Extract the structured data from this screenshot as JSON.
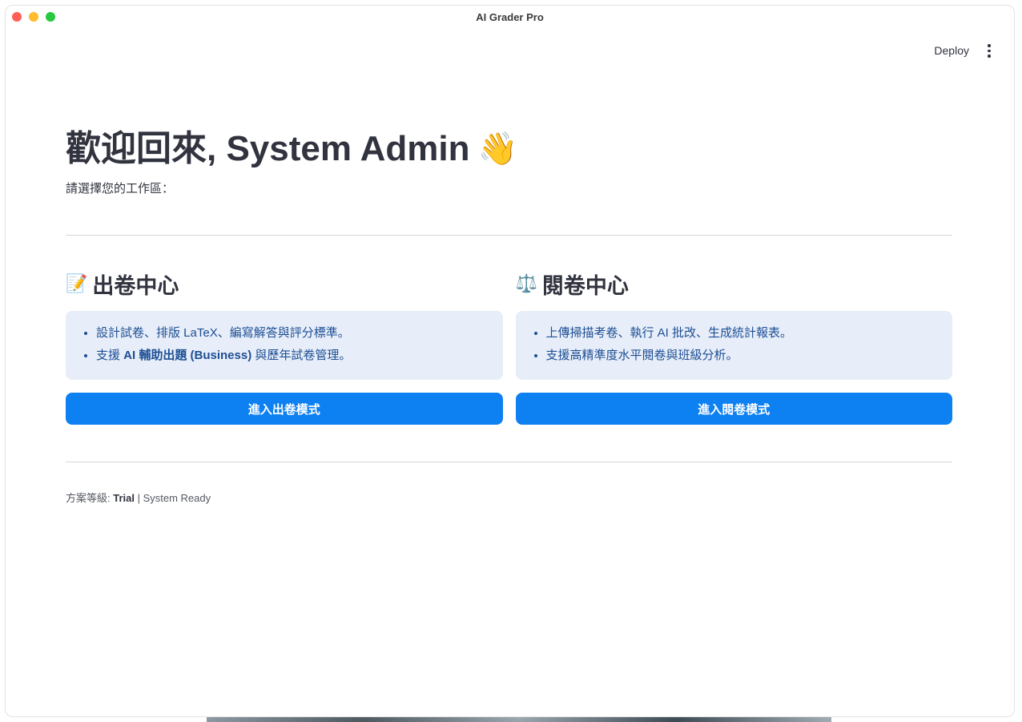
{
  "window": {
    "title": "AI Grader Pro"
  },
  "toolbar": {
    "deploy_label": "Deploy",
    "menu_icon": "more-vertical-icon"
  },
  "main": {
    "welcome_text": "歡迎回來, System Admin",
    "welcome_emoji": "👋",
    "subtitle": "請選擇您的工作區："
  },
  "workspaces": [
    {
      "emoji": "📝",
      "title": "出卷中心",
      "bullets": [
        {
          "prefix": "設計試卷、排版 LaTeX、編寫解答與評分標準。",
          "bold": "",
          "suffix": ""
        },
        {
          "prefix": "支援 ",
          "bold": "AI 輔助出題 (Business)",
          "suffix": " 與歷年試卷管理。"
        }
      ],
      "button_label": "進入出卷模式"
    },
    {
      "emoji": "⚖️",
      "title": "閱卷中心",
      "bullets": [
        {
          "prefix": "上傳掃描考卷、執行 AI 批改、生成統計報表。",
          "bold": "",
          "suffix": ""
        },
        {
          "prefix": "支援高精準度水平閱卷與班級分析。",
          "bold": "",
          "suffix": ""
        }
      ],
      "button_label": "進入閱卷模式"
    }
  ],
  "footer": {
    "plan_label": "方案等級: ",
    "plan_value": "Trial",
    "status": " | System Ready"
  },
  "colors": {
    "accent": "#0d80f2",
    "info_bg": "#e8eef9",
    "info_text": "#1c4e94"
  }
}
